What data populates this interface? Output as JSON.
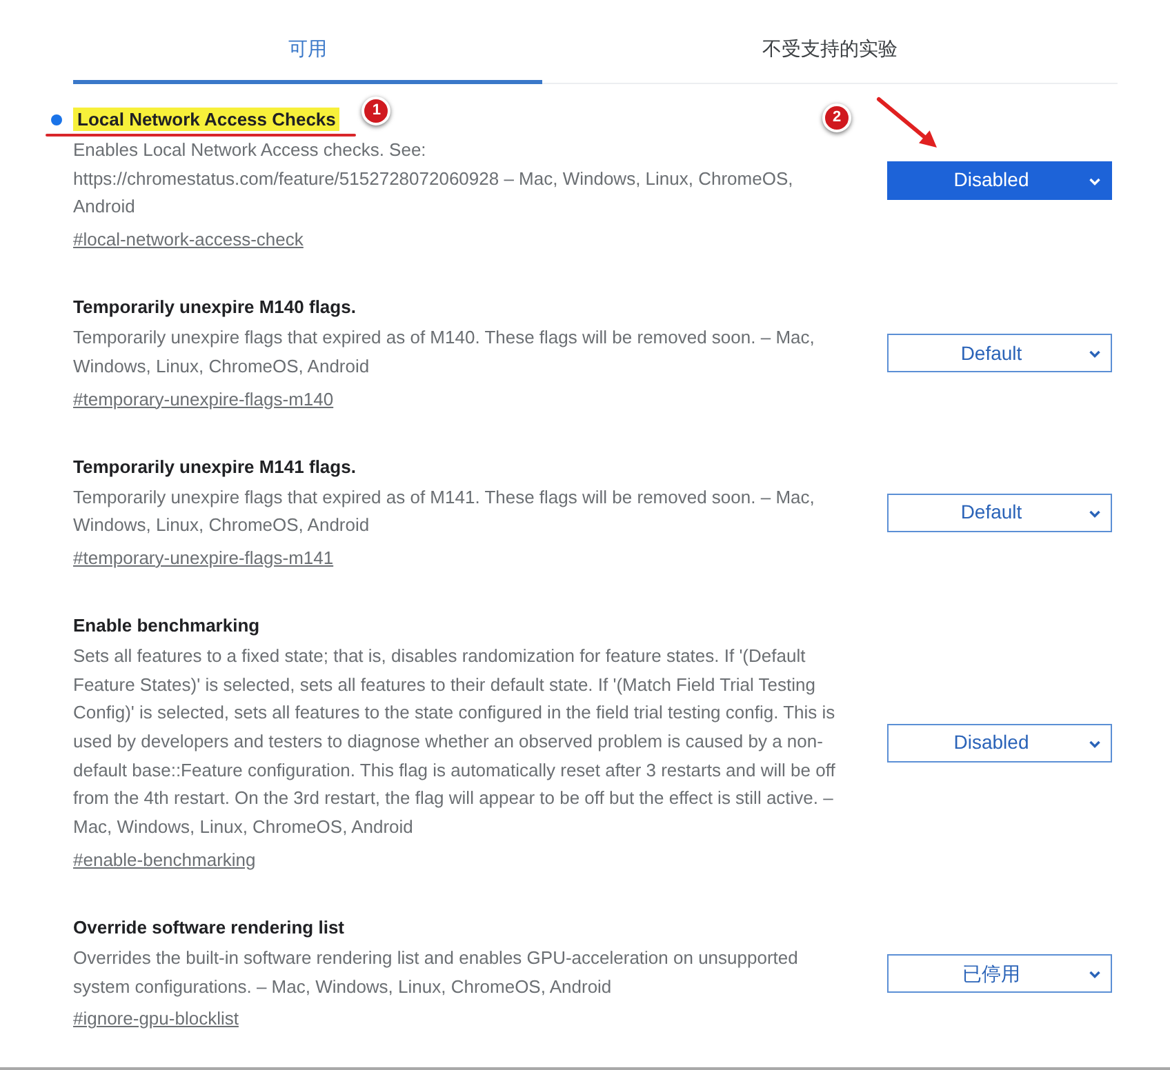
{
  "tabs": [
    {
      "label": "可用",
      "selected": true
    },
    {
      "label": "不受支持的实验",
      "selected": false
    }
  ],
  "experiments": [
    {
      "title": "Local Network Access Checks",
      "modified": true,
      "highlighted": true,
      "description": "Enables Local Network Access checks. See: https://chromestatus.com/feature/5152728072060928 – Mac, Windows, Linux, ChromeOS, Android",
      "link": "#local-network-access-check",
      "value": "Disabled",
      "annotations": [
        {
          "number": "1",
          "kind": "underline"
        },
        {
          "number": "2",
          "kind": "arrow"
        }
      ]
    },
    {
      "title": "Temporarily unexpire M140 flags.",
      "modified": false,
      "highlighted": false,
      "description": "Temporarily unexpire flags that expired as of M140. These flags will be removed soon. – Mac, Windows, Linux, ChromeOS, Android",
      "link": "#temporary-unexpire-flags-m140",
      "value": "Default"
    },
    {
      "title": "Temporarily unexpire M141 flags.",
      "modified": false,
      "highlighted": false,
      "description": "Temporarily unexpire flags that expired as of M141. These flags will be removed soon. – Mac, Windows, Linux, ChromeOS, Android",
      "link": "#temporary-unexpire-flags-m141",
      "value": "Default"
    },
    {
      "title": "Enable benchmarking",
      "modified": false,
      "highlighted": false,
      "description": "Sets all features to a fixed state; that is, disables randomization for feature states. If '(Default Feature States)' is selected, sets all features to their default state. If '(Match Field Trial Testing Config)' is selected, sets all features to the state configured in the field trial testing config. This is used by developers and testers to diagnose whether an observed problem is caused by a non-default base::Feature configuration. This flag is automatically reset after 3 restarts and will be off from the 4th restart. On the 3rd restart, the flag will appear to be off but the effect is still active. – Mac, Windows, Linux, ChromeOS, Android",
      "link": "#enable-benchmarking",
      "value": "Disabled"
    },
    {
      "title": "Override software rendering list",
      "modified": false,
      "highlighted": false,
      "description": "Overrides the built-in software rendering list and enables GPU-acceleration on unsupported system configurations. – Mac, Windows, Linux, ChromeOS, Android",
      "link": "#ignore-gpu-blocklist",
      "value": "已停用"
    }
  ]
}
